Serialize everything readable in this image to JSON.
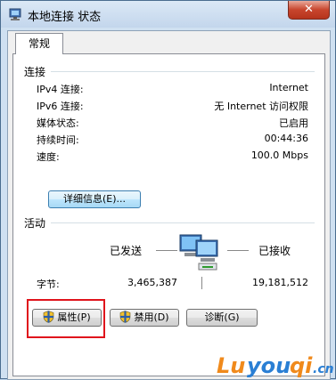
{
  "window": {
    "title": "本地连接 状态",
    "close_label": "✕"
  },
  "tabs": [
    {
      "label": "常规"
    }
  ],
  "connection": {
    "heading": "连接",
    "rows": [
      {
        "label": "IPv4 连接:",
        "value": "Internet"
      },
      {
        "label": "IPv6 连接:",
        "value": "无 Internet 访问权限"
      },
      {
        "label": "媒体状态:",
        "value": "已启用"
      },
      {
        "label": "持续时间:",
        "value": "00:44:36"
      },
      {
        "label": "速度:",
        "value": "100.0 Mbps"
      }
    ],
    "details_button": "详细信息(E)..."
  },
  "activity": {
    "heading": "活动",
    "sent_label": "已发送",
    "received_label": "已接收",
    "bytes_label": "字节:",
    "bytes_sent": "3,465,387",
    "bytes_received": "19,181,512"
  },
  "buttons": {
    "properties": "属性(P)",
    "disable": "禁用(D)",
    "diagnose": "诊断(G)"
  },
  "icons": {
    "title": "network-connection-icon",
    "activity": "network-computers-icon",
    "shield": "uac-shield-icon"
  },
  "colors": {
    "highlight": "#e0141c",
    "close": "#c8452d",
    "window_frame": "#cfe0f1",
    "watermark_orange": "#f08a1c",
    "watermark_blue": "#2a7fd4"
  },
  "watermark": {
    "text": "Luyouqi.cn"
  }
}
